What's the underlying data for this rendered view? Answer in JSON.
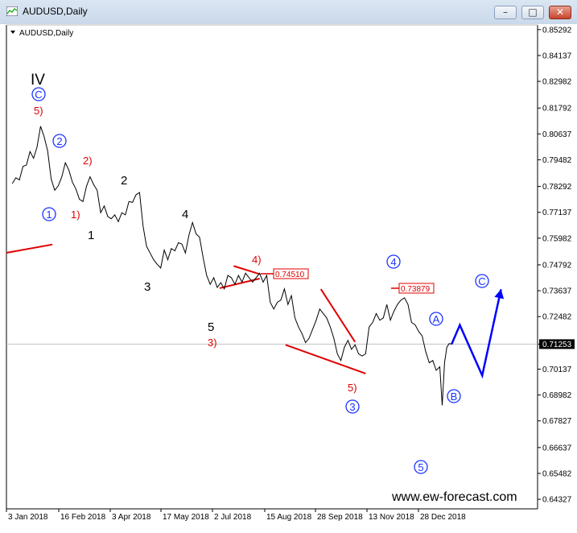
{
  "window": {
    "title": "AUDUSD,Daily",
    "minimize_glyph": "–",
    "maximize_glyph": "□",
    "close_glyph": "✕"
  },
  "chart_data": {
    "type": "line",
    "symbol_label": "AUDUSD,Daily",
    "current_price": "0.71253",
    "price_ticks": [
      "0.85292",
      "0.84137",
      "0.82982",
      "0.81792",
      "0.80637",
      "0.79482",
      "0.78292",
      "0.77137",
      "0.75982",
      "0.74792",
      "0.73637",
      "0.72482",
      "0.71253",
      "0.70137",
      "0.68982",
      "0.67827",
      "0.66637",
      "0.65482",
      "0.64327"
    ],
    "date_ticks": [
      "3 Jan 2018",
      "16 Feb 2018",
      "3 Apr 2018",
      "17 May 2018",
      "2 Jul 2018",
      "15 Aug 2018",
      "28 Sep 2018",
      "13 Nov 2018",
      "28 Dec 2018"
    ],
    "price_boxes": [
      "0.74510",
      "0.73879"
    ],
    "wave_labels": {
      "roman": "IV",
      "circled": [
        "C",
        "2",
        "1",
        "4",
        "C",
        "A",
        "B",
        "3",
        "5"
      ],
      "red": [
        "5)",
        "2)",
        "1)",
        "4)",
        "3)",
        "5)"
      ],
      "black": [
        "2",
        "1",
        "4",
        "3",
        "5"
      ]
    },
    "watermark": "www.ew-forecast.com",
    "series": [
      {
        "values": [
          [
            "2018-01-03",
            0.7842
          ],
          [
            "2018-01-06",
            0.7868
          ],
          [
            "2018-01-09",
            0.7858
          ],
          [
            "2018-01-12",
            0.7918
          ],
          [
            "2018-01-15",
            0.7925
          ],
          [
            "2018-01-18",
            0.7985
          ],
          [
            "2018-01-21",
            0.7955
          ],
          [
            "2018-01-24",
            0.8005
          ],
          [
            "2018-01-27",
            0.8098
          ],
          [
            "2018-01-30",
            0.8052
          ],
          [
            "2018-02-02",
            0.7988
          ],
          [
            "2018-02-05",
            0.7862
          ],
          [
            "2018-02-08",
            0.7812
          ],
          [
            "2018-02-11",
            0.7832
          ],
          [
            "2018-02-14",
            0.7872
          ],
          [
            "2018-02-17",
            0.7935
          ],
          [
            "2018-02-20",
            0.7902
          ],
          [
            "2018-02-23",
            0.7848
          ],
          [
            "2018-02-26",
            0.7818
          ],
          [
            "2018-03-01",
            0.7772
          ],
          [
            "2018-03-04",
            0.7762
          ],
          [
            "2018-03-07",
            0.783
          ],
          [
            "2018-03-10",
            0.7872
          ],
          [
            "2018-03-13",
            0.7838
          ],
          [
            "2018-03-16",
            0.7812
          ],
          [
            "2018-03-19",
            0.7712
          ],
          [
            "2018-03-22",
            0.7742
          ],
          [
            "2018-03-25",
            0.7695
          ],
          [
            "2018-03-28",
            0.7685
          ],
          [
            "2018-03-31",
            0.7702
          ],
          [
            "2018-04-03",
            0.7672
          ],
          [
            "2018-04-06",
            0.7712
          ],
          [
            "2018-04-09",
            0.7702
          ],
          [
            "2018-04-12",
            0.7762
          ],
          [
            "2018-04-15",
            0.7758
          ],
          [
            "2018-04-18",
            0.7792
          ],
          [
            "2018-04-21",
            0.7802
          ],
          [
            "2018-04-24",
            0.7652
          ],
          [
            "2018-04-27",
            0.7562
          ],
          [
            "2018-04-30",
            0.7532
          ],
          [
            "2018-05-03",
            0.7502
          ],
          [
            "2018-05-06",
            0.7482
          ],
          [
            "2018-05-09",
            0.7465
          ],
          [
            "2018-05-12",
            0.7545
          ],
          [
            "2018-05-15",
            0.7502
          ],
          [
            "2018-05-18",
            0.7552
          ],
          [
            "2018-05-21",
            0.7542
          ],
          [
            "2018-05-24",
            0.7578
          ],
          [
            "2018-05-27",
            0.7572
          ],
          [
            "2018-05-30",
            0.7532
          ],
          [
            "2018-06-02",
            0.7612
          ],
          [
            "2018-06-05",
            0.7668
          ],
          [
            "2018-06-08",
            0.7618
          ],
          [
            "2018-06-11",
            0.7602
          ],
          [
            "2018-06-14",
            0.7512
          ],
          [
            "2018-06-17",
            0.7432
          ],
          [
            "2018-06-20",
            0.7392
          ],
          [
            "2018-06-23",
            0.7422
          ],
          [
            "2018-06-26",
            0.7378
          ],
          [
            "2018-06-29",
            0.74
          ],
          [
            "2018-07-02",
            0.7372
          ],
          [
            "2018-07-05",
            0.7432
          ],
          [
            "2018-07-08",
            0.7422
          ],
          [
            "2018-07-11",
            0.7392
          ],
          [
            "2018-07-14",
            0.7432
          ],
          [
            "2018-07-17",
            0.7402
          ],
          [
            "2018-07-20",
            0.7442
          ],
          [
            "2018-07-23",
            0.7422
          ],
          [
            "2018-07-26",
            0.7402
          ],
          [
            "2018-07-29",
            0.7422
          ],
          [
            "2018-08-01",
            0.7442
          ],
          [
            "2018-08-04",
            0.7402
          ],
          [
            "2018-08-07",
            0.7432
          ],
          [
            "2018-08-10",
            0.7312
          ],
          [
            "2018-08-13",
            0.7282
          ],
          [
            "2018-08-16",
            0.7312
          ],
          [
            "2018-08-19",
            0.7322
          ],
          [
            "2018-08-22",
            0.7372
          ],
          [
            "2018-08-25",
            0.7302
          ],
          [
            "2018-08-28",
            0.7342
          ],
          [
            "2018-08-31",
            0.7242
          ],
          [
            "2018-09-03",
            0.7202
          ],
          [
            "2018-09-06",
            0.7172
          ],
          [
            "2018-09-09",
            0.7132
          ],
          [
            "2018-09-12",
            0.7152
          ],
          [
            "2018-09-15",
            0.7192
          ],
          [
            "2018-09-18",
            0.7232
          ],
          [
            "2018-09-21",
            0.7282
          ],
          [
            "2018-09-24",
            0.7262
          ],
          [
            "2018-09-27",
            0.7242
          ],
          [
            "2018-09-30",
            0.7202
          ],
          [
            "2018-10-03",
            0.7152
          ],
          [
            "2018-10-06",
            0.7082
          ],
          [
            "2018-10-09",
            0.7052
          ],
          [
            "2018-10-12",
            0.7112
          ],
          [
            "2018-10-15",
            0.7142
          ],
          [
            "2018-10-18",
            0.7102
          ],
          [
            "2018-10-21",
            0.7122
          ],
          [
            "2018-10-24",
            0.7082
          ],
          [
            "2018-10-27",
            0.7072
          ],
          [
            "2018-10-30",
            0.7082
          ],
          [
            "2018-11-02",
            0.7202
          ],
          [
            "2018-11-05",
            0.7222
          ],
          [
            "2018-11-08",
            0.7262
          ],
          [
            "2018-11-11",
            0.7232
          ],
          [
            "2018-11-14",
            0.7242
          ],
          [
            "2018-11-17",
            0.7302
          ],
          [
            "2018-11-20",
            0.7232
          ],
          [
            "2018-11-23",
            0.7272
          ],
          [
            "2018-11-26",
            0.7302
          ],
          [
            "2018-11-29",
            0.7322
          ],
          [
            "2018-12-02",
            0.7332
          ],
          [
            "2018-12-05",
            0.7302
          ],
          [
            "2018-12-08",
            0.7222
          ],
          [
            "2018-12-11",
            0.7212
          ],
          [
            "2018-12-14",
            0.7182
          ],
          [
            "2018-12-17",
            0.7162
          ],
          [
            "2018-12-20",
            0.7092
          ],
          [
            "2018-12-23",
            0.7042
          ],
          [
            "2018-12-26",
            0.7052
          ],
          [
            "2018-12-29",
            0.7008
          ],
          [
            "2019-01-01",
            0.7024
          ],
          [
            "2019-01-03",
            0.6852
          ],
          [
            "2019-01-05",
            0.7042
          ],
          [
            "2019-01-07",
            0.7112
          ],
          [
            "2019-01-09",
            0.7128
          ],
          [
            "2019-01-11",
            0.7125
          ]
        ]
      },
      {
        "name": "projection",
        "values": [
          [
            "2019-01-11",
            0.7125
          ],
          [
            "2019-01-18",
            0.721
          ],
          [
            "2019-02-06",
            0.6985
          ],
          [
            "2019-02-22",
            0.737
          ]
        ]
      }
    ],
    "trendlines": [
      [
        [
          "2017-12-29",
          0.7533
        ],
        [
          "2018-02-06",
          0.757
        ]
      ],
      [
        [
          "2018-06-28",
          0.7375
        ],
        [
          "2018-08-01",
          0.7418
        ]
      ],
      [
        [
          "2018-07-10",
          0.7474
        ],
        [
          "2018-08-01",
          0.7438
        ]
      ],
      [
        [
          "2018-08-23",
          0.7122
        ],
        [
          "2018-10-30",
          0.6994
        ]
      ],
      [
        [
          "2018-09-22",
          0.7371
        ],
        [
          "2018-10-21",
          0.7135
        ]
      ]
    ],
    "y_range": [
      0.639,
      0.855
    ],
    "x_range": [
      "2017-12-29",
      "2019-03-25"
    ],
    "grid": false,
    "colors": {
      "price": "#000000",
      "trend": "#e00000",
      "projection": "#0000ff",
      "wave_blue": "#1a33ff",
      "wave_red": "#e00000",
      "current_price_box": "#000000"
    }
  }
}
